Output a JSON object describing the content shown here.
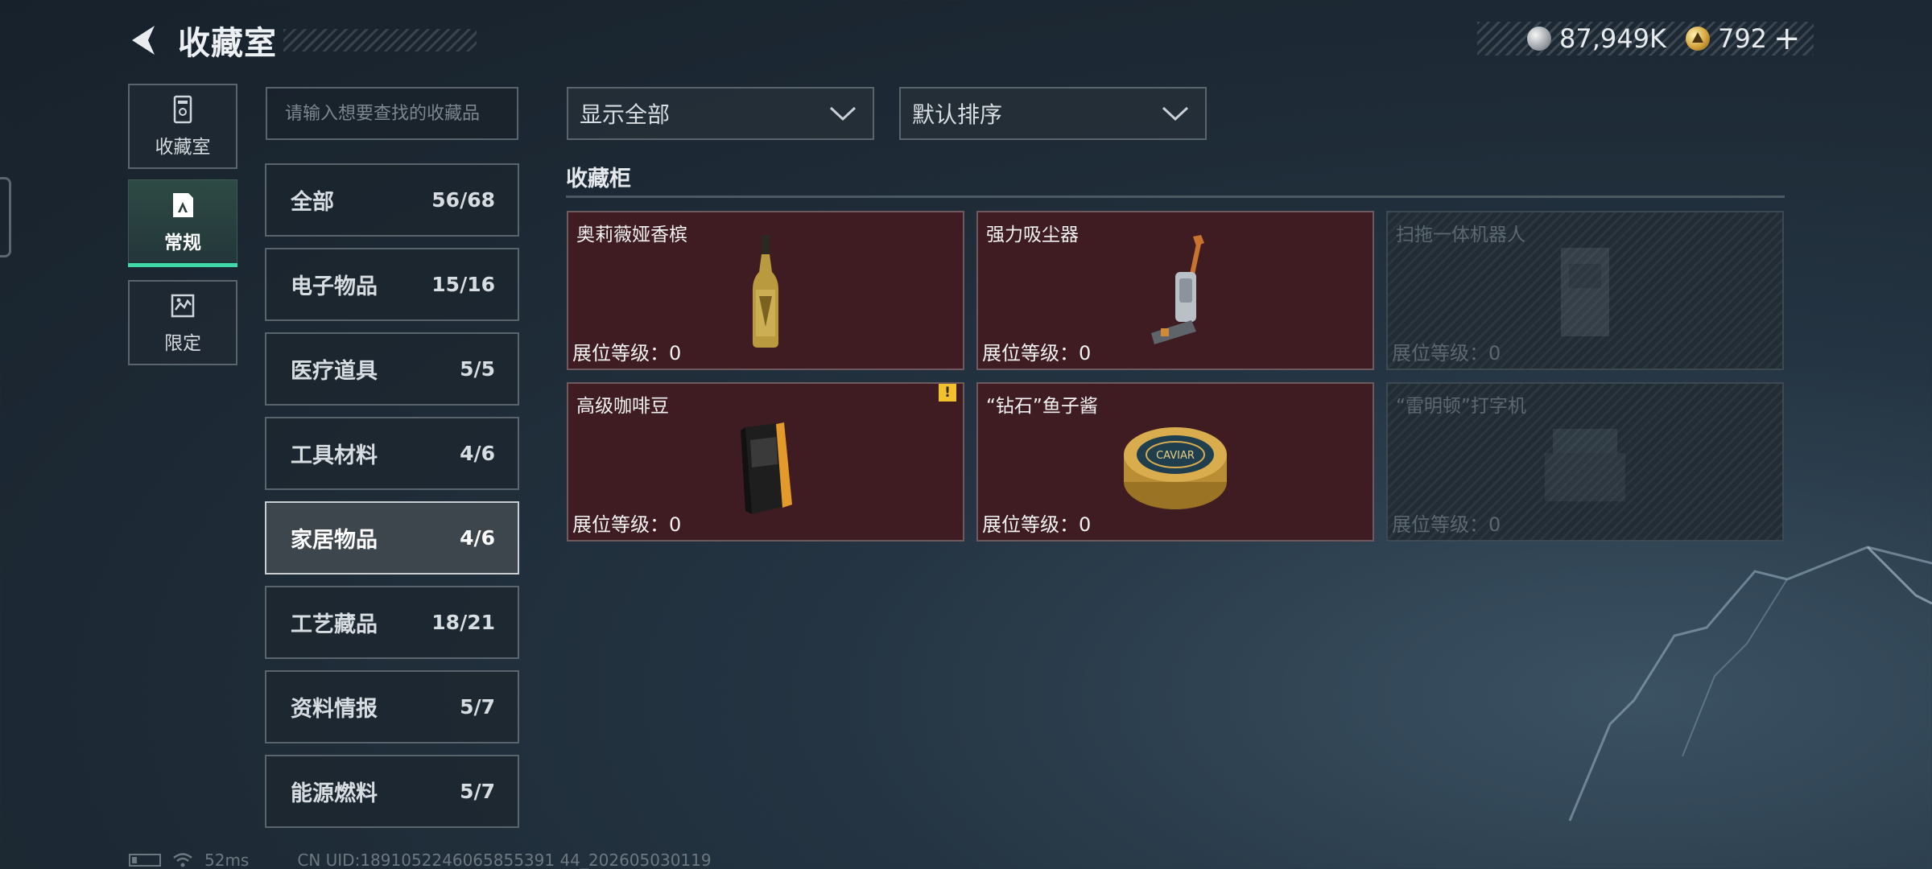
{
  "header": {
    "title": "收藏室",
    "currency": [
      {
        "icon": "silver-coin-icon",
        "value": "87,949K"
      },
      {
        "icon": "gold-coin-icon",
        "value": "792"
      }
    ],
    "add_symbol": "+"
  },
  "side_tabs": [
    {
      "label": "收藏室",
      "icon": "collection-room-icon",
      "active": false
    },
    {
      "label": "常规",
      "icon": "regular-icon",
      "active": true
    },
    {
      "label": "限定",
      "icon": "limited-icon",
      "active": false
    }
  ],
  "search": {
    "placeholder": "请输入想要查找的收藏品",
    "value": ""
  },
  "categories": [
    {
      "name": "全部",
      "count": "56/68",
      "selected": false
    },
    {
      "name": "电子物品",
      "count": "15/16",
      "selected": false
    },
    {
      "name": "医疗道具",
      "count": "5/5",
      "selected": false
    },
    {
      "name": "工具材料",
      "count": "4/6",
      "selected": false
    },
    {
      "name": "家居物品",
      "count": "4/6",
      "selected": true
    },
    {
      "name": "工艺藏品",
      "count": "18/21",
      "selected": false
    },
    {
      "name": "资料情报",
      "count": "5/7",
      "selected": false
    },
    {
      "name": "能源燃料",
      "count": "5/7",
      "selected": false
    }
  ],
  "filters": {
    "display": "显示全部",
    "sort": "默认排序"
  },
  "section": {
    "title": "收藏柜"
  },
  "cards": [
    {
      "name": "奥莉薇娅香槟",
      "level": "展位等级：0",
      "locked": false,
      "icon": "champagne-bottle-icon",
      "warning": false
    },
    {
      "name": "强力吸尘器",
      "level": "展位等级：0",
      "locked": false,
      "icon": "vacuum-cleaner-icon",
      "warning": false
    },
    {
      "name": "扫拖一体机器人",
      "level": "展位等级：0",
      "locked": true,
      "icon": "robot-mop-icon",
      "warning": false
    },
    {
      "name": "高级咖啡豆",
      "level": "展位等级：0",
      "locked": false,
      "icon": "coffee-bag-icon",
      "warning": true
    },
    {
      "name": "“钻石”鱼子酱",
      "level": "展位等级：0",
      "locked": false,
      "icon": "caviar-tin-icon",
      "warning": false
    },
    {
      "name": "“雷明顿”打字机",
      "level": "展位等级：0",
      "locked": true,
      "icon": "typewriter-icon",
      "warning": false
    }
  ],
  "caviar_label": "CAVIAR",
  "warning_mark": "!",
  "status_bar": {
    "ping": "52ms",
    "uid": "CN UID:1891052246065855391 44_202605030119"
  }
}
